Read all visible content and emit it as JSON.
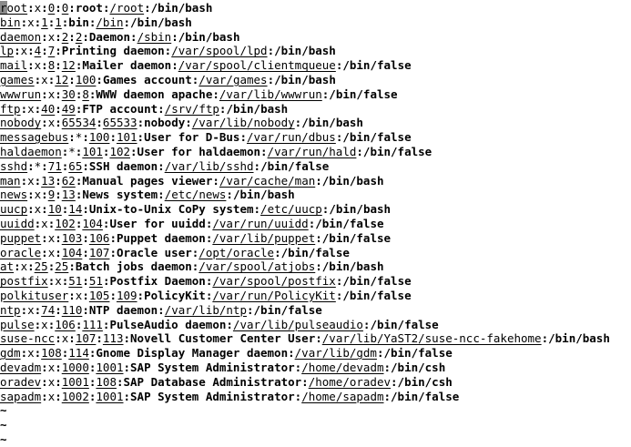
{
  "terminal": {
    "cursor_char": "r",
    "lines": [
      [
        "root",
        "x",
        "0",
        "0",
        "root",
        "/root",
        "/bin/bash"
      ],
      [
        "bin",
        "x",
        "1",
        "1",
        "bin",
        "/bin",
        "/bin/bash"
      ],
      [
        "daemon",
        "x",
        "2",
        "2",
        "Daemon",
        "/sbin",
        "/bin/bash"
      ],
      [
        "lp",
        "x",
        "4",
        "7",
        "Printing daemon",
        "/var/spool/lpd",
        "/bin/bash"
      ],
      [
        "mail",
        "x",
        "8",
        "12",
        "Mailer daemon",
        "/var/spool/clientmqueue",
        "/bin/false"
      ],
      [
        "games",
        "x",
        "12",
        "100",
        "Games account",
        "/var/games",
        "/bin/bash"
      ],
      [
        "wwwrun",
        "x",
        "30",
        "8",
        "WWW daemon apache",
        "/var/lib/wwwrun",
        "/bin/false"
      ],
      [
        "ftp",
        "x",
        "40",
        "49",
        "FTP account",
        "/srv/ftp",
        "/bin/bash"
      ],
      [
        "nobody",
        "x",
        "65534",
        "65533",
        "nobody",
        "/var/lib/nobody",
        "/bin/bash"
      ],
      [
        "messagebus",
        "*",
        "100",
        "101",
        "User for D-Bus",
        "/var/run/dbus",
        "/bin/false"
      ],
      [
        "haldaemon",
        "*",
        "101",
        "102",
        "User for haldaemon",
        "/var/run/hald",
        "/bin/false"
      ],
      [
        "sshd",
        "*",
        "71",
        "65",
        "SSH daemon",
        "/var/lib/sshd",
        "/bin/false"
      ],
      [
        "man",
        "x",
        "13",
        "62",
        "Manual pages viewer",
        "/var/cache/man",
        "/bin/bash"
      ],
      [
        "news",
        "x",
        "9",
        "13",
        "News system",
        "/etc/news",
        "/bin/bash"
      ],
      [
        "uucp",
        "x",
        "10",
        "14",
        "Unix-to-Unix CoPy system",
        "/etc/uucp",
        "/bin/bash"
      ],
      [
        "uuidd",
        "x",
        "102",
        "104",
        "User for uuidd",
        "/var/run/uuidd",
        "/bin/false"
      ],
      [
        "puppet",
        "x",
        "103",
        "106",
        "Puppet daemon",
        "/var/lib/puppet",
        "/bin/false"
      ],
      [
        "oracle",
        "x",
        "104",
        "107",
        "Oracle user",
        "/opt/oracle",
        "/bin/false"
      ],
      [
        "at",
        "x",
        "25",
        "25",
        "Batch jobs daemon",
        "/var/spool/atjobs",
        "/bin/bash"
      ],
      [
        "postfix",
        "x",
        "51",
        "51",
        "Postfix Daemon",
        "/var/spool/postfix",
        "/bin/false"
      ],
      [
        "polkituser",
        "x",
        "105",
        "109",
        "PolicyKit",
        "/var/run/PolicyKit",
        "/bin/false"
      ],
      [
        "ntp",
        "x",
        "74",
        "110",
        "NTP daemon",
        "/var/lib/ntp",
        "/bin/false"
      ],
      [
        "pulse",
        "x",
        "106",
        "111",
        "PulseAudio daemon",
        "/var/lib/pulseaudio",
        "/bin/false"
      ],
      [
        "suse-ncc",
        "x",
        "107",
        "113",
        "Novell Customer Center User",
        "/var/lib/YaST2/suse-ncc-fakehome",
        "/bin/bash"
      ],
      [
        "gdm",
        "x",
        "108",
        "114",
        "Gnome Display Manager daemon",
        "/var/lib/gdm",
        "/bin/false"
      ],
      [
        "devadm",
        "x",
        "1000",
        "1001",
        "SAP System Administrator",
        "/home/devadm",
        "/bin/csh"
      ],
      [
        "oradev",
        "x",
        "1001",
        "108",
        "SAP Database Administrator",
        "/home/oradev",
        "/bin/csh"
      ],
      [
        "sapadm",
        "x",
        "1002",
        "1001",
        "SAP System Administrator",
        "/home/sapadm",
        "/bin/false"
      ]
    ],
    "empty_line_marker": "~",
    "empty_line_count": 3
  }
}
